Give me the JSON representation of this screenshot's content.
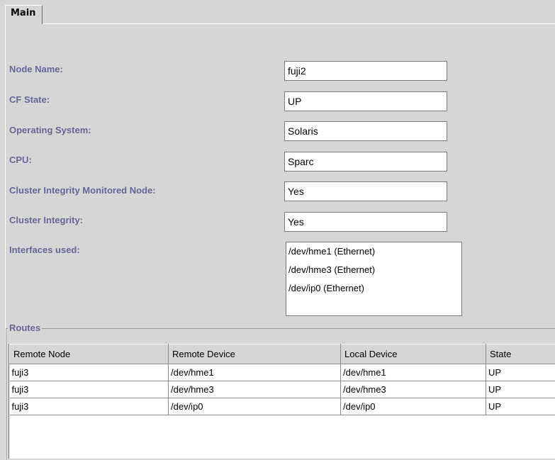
{
  "tabs": [
    {
      "label": "Main"
    }
  ],
  "fields": {
    "node_name": {
      "label": "Node Name:",
      "value": "fuji2"
    },
    "cf_state": {
      "label": "CF State:",
      "value": "UP"
    },
    "operating_system": {
      "label": "Operating System:",
      "value": "Solaris"
    },
    "cpu": {
      "label": "CPU:",
      "value": "Sparc"
    },
    "cluster_integrity_monitored_node": {
      "label": "Cluster Integrity Monitored Node:",
      "value": "Yes"
    },
    "cluster_integrity": {
      "label": "Cluster Integrity:",
      "value": "Yes"
    },
    "interfaces_used": {
      "label": "Interfaces used:",
      "items": [
        "/dev/hme1 (Ethernet)",
        "/dev/hme3 (Ethernet)",
        "/dev/ip0 (Ethernet)"
      ]
    }
  },
  "routes": {
    "title": "Routes",
    "columns": [
      "Remote Node",
      "Remote Device",
      "Local Device",
      "State"
    ],
    "rows": [
      [
        "fuji3",
        "/dev/hme1",
        "/dev/hme1",
        "UP"
      ],
      [
        "fuji3",
        "/dev/hme3",
        "/dev/hme3",
        "UP"
      ],
      [
        "fuji3",
        "/dev/ip0",
        "/dev/ip0",
        "UP"
      ]
    ]
  }
}
